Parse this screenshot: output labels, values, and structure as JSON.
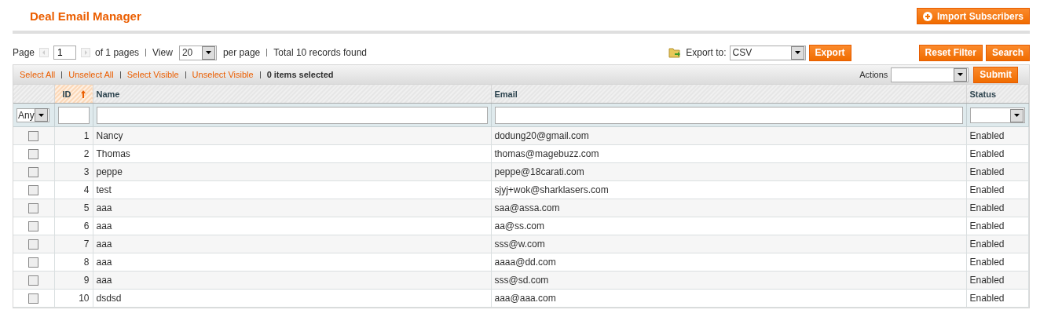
{
  "header": {
    "title": "Deal Email Manager",
    "import_button": "Import Subscribers"
  },
  "pager": {
    "page_label": "Page",
    "page": "1",
    "of_pages": "of 1 pages",
    "view_label": "View",
    "per_page": "20",
    "per_page_label": "per page",
    "total": "Total 10 records found"
  },
  "export": {
    "label": "Export to:",
    "format": "CSV",
    "button": "Export"
  },
  "grid_buttons": [
    "Reset Filter",
    "Search"
  ],
  "massaction": {
    "links": [
      "Select All",
      "Unselect All",
      "Select Visible",
      "Unselect Visible"
    ],
    "selected_count": "0",
    "selected_label": "items selected",
    "actions_label": "Actions",
    "submit": "Submit"
  },
  "table": {
    "columns": [
      {
        "sorted": false
      },
      {
        "label": "ID",
        "sorted": true
      },
      {
        "label": "Name",
        "sorted": false
      },
      {
        "label": "Email",
        "sorted": false
      },
      {
        "label": "Status",
        "sorted": false
      }
    ],
    "filters": {
      "checkbox_select": "Any"
    },
    "rows": [
      {
        "checked": false,
        "id": "1",
        "name": "Nancy",
        "email": "dodung20@gmail.com",
        "status": "Enabled"
      },
      {
        "checked": false,
        "id": "2",
        "name": "Thomas",
        "email": "thomas@magebuzz.com",
        "status": "Enabled"
      },
      {
        "checked": false,
        "id": "3",
        "name": "peppe",
        "email": "peppe@18carati.com",
        "status": "Enabled"
      },
      {
        "checked": false,
        "id": "4",
        "name": "test",
        "email": "sjyj+wok@sharklasers.com",
        "status": "Enabled"
      },
      {
        "checked": false,
        "id": "5",
        "name": "aaa",
        "email": "saa@assa.com",
        "status": "Enabled"
      },
      {
        "checked": false,
        "id": "6",
        "name": "aaa",
        "email": "aa@ss.com",
        "status": "Enabled"
      },
      {
        "checked": false,
        "id": "7",
        "name": "aaa",
        "email": "sss@w.com",
        "status": "Enabled"
      },
      {
        "checked": false,
        "id": "8",
        "name": "aaa",
        "email": "aaaa@dd.com",
        "status": "Enabled"
      },
      {
        "checked": false,
        "id": "9",
        "name": "aaa",
        "email": "sss@sd.com",
        "status": "Enabled"
      },
      {
        "checked": false,
        "id": "10",
        "name": "dsdsd",
        "email": "aaa@aaa.com",
        "status": "Enabled"
      }
    ]
  }
}
